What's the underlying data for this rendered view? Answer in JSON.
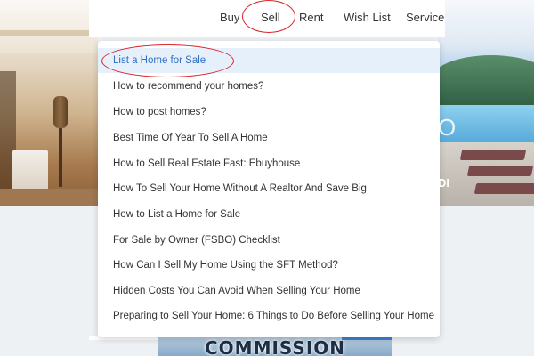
{
  "header": {
    "nav": [
      {
        "label": "Buy"
      },
      {
        "label": "Sell"
      },
      {
        "label": "Rent"
      },
      {
        "label": "Wish List"
      },
      {
        "label": "Service"
      }
    ]
  },
  "sell_menu": {
    "items": [
      {
        "label": "List a Home for Sale",
        "active": true
      },
      {
        "label": "How to recommend your homes?"
      },
      {
        "label": "How to post homes?"
      },
      {
        "label": "Best Time Of Year To Sell A Home"
      },
      {
        "label": "How to Sell Real Estate Fast: Ebuyhouse"
      },
      {
        "label": "How To Sell Your Home Without A Realtor And Save Big"
      },
      {
        "label": "How to List a Home for Sale"
      },
      {
        "label": "For Sale by Owner (FSBO) Checklist"
      },
      {
        "label": "How Can I Sell My Home Using the SFT Method?"
      },
      {
        "label": "Hidden Costs You Can Avoid When Selling Your Home"
      },
      {
        "label": "Preparing to Sell Your Home: 6 Things to Do Before Selling Your Home"
      }
    ]
  },
  "background": {
    "right_text": "DI",
    "right_letter": "O",
    "bottom_banner": "COMMISSION"
  },
  "colors": {
    "highlight_circle": "#d9252b",
    "active_item_bg": "#e6f0fb",
    "active_item_text": "#2f6fc4",
    "text": "#333333"
  }
}
